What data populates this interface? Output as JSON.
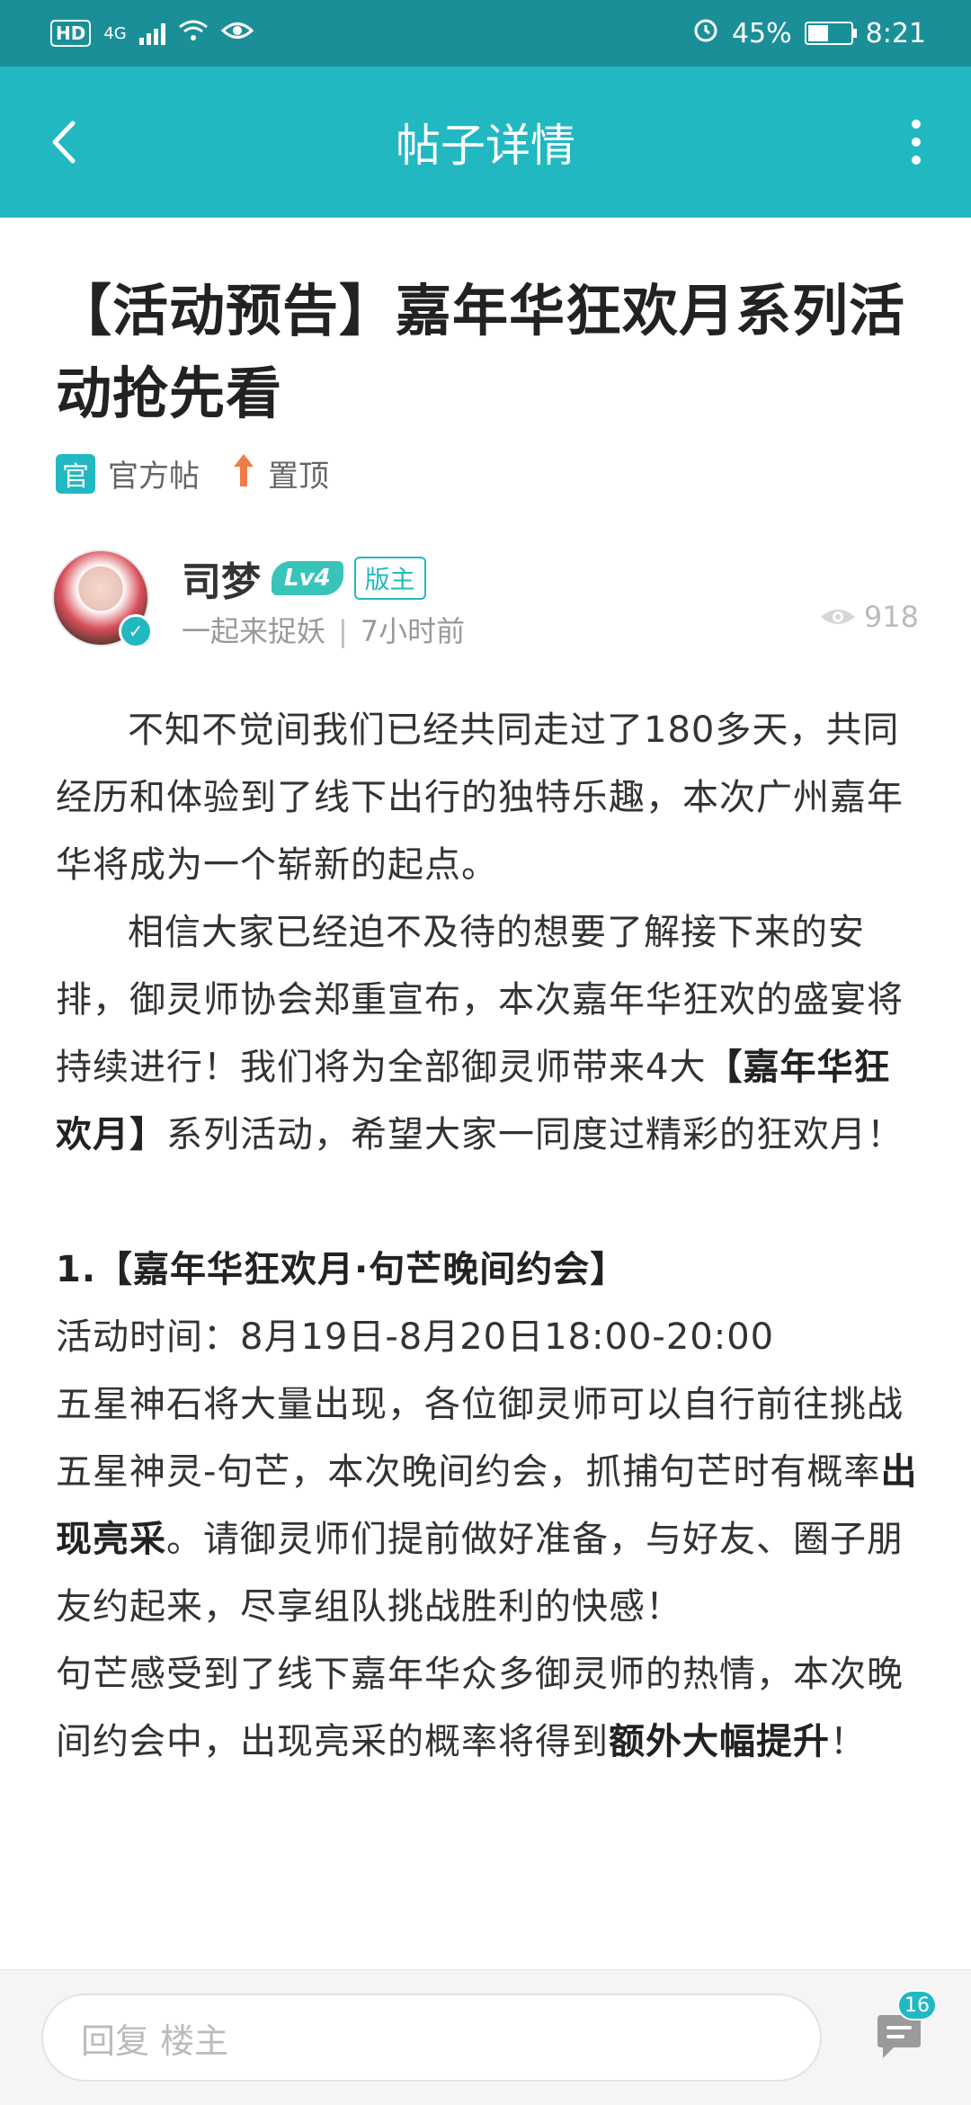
{
  "status_bar": {
    "hd": "HD",
    "network": "4G",
    "battery": "45%",
    "time": "8:21"
  },
  "header": {
    "title": "帖子详情"
  },
  "post": {
    "title": "【活动预告】嘉年华狂欢月系列活动抢先看",
    "tags": [
      {
        "icon_text": "官",
        "label": "官方帖"
      },
      {
        "icon": "arrow-up-icon",
        "label": "置顶"
      }
    ],
    "author": {
      "name": "司梦",
      "level": "Lv4",
      "role": "版主",
      "board": "一起来捉妖",
      "time": "7小时前",
      "views": "918"
    },
    "body": {
      "p1": "不知不觉间我们已经共同走过了180多天，共同经历和体验到了线下出行的独特乐趣，本次广州嘉年华将成为一个崭新的起点。",
      "p2_a": "相信大家已经迫不及待的想要了解接下来的安排，御灵师协会郑重宣布，本次嘉年华狂欢的盛宴将持续进行！我们将为全部御灵师带来4大",
      "p2_b": "【嘉年华狂欢月】",
      "p2_c": "系列活动，希望大家一同度过精彩的狂欢月！",
      "section1_title": "1.【嘉年华狂欢月·句芒晚间约会】",
      "section1_time": "活动时间：8月19日-8月20日18:00-20:00",
      "section1_a": "五星神石将大量出现，各位御灵师可以自行前往挑战五星神灵-句芒，本次晚间约会，抓捕句芒时有概率",
      "section1_b": "出现亮采",
      "section1_c": "。请御灵师们提前做好准备，与好友、圈子朋友约起来，尽享组队挑战胜利的快感！",
      "section1_d": "句芒感受到了线下嘉年华众多御灵师的热情，本次晚间约会中，出现亮采的概率将得到",
      "section1_e": "额外大幅提升",
      "section1_f": "！"
    }
  },
  "reply_bar": {
    "placeholder": "回复  楼主",
    "comment_count": "16"
  },
  "colors": {
    "accent": "#22b8c2",
    "status_bar": "#1b8f97",
    "top_tag": "#f07b47"
  }
}
